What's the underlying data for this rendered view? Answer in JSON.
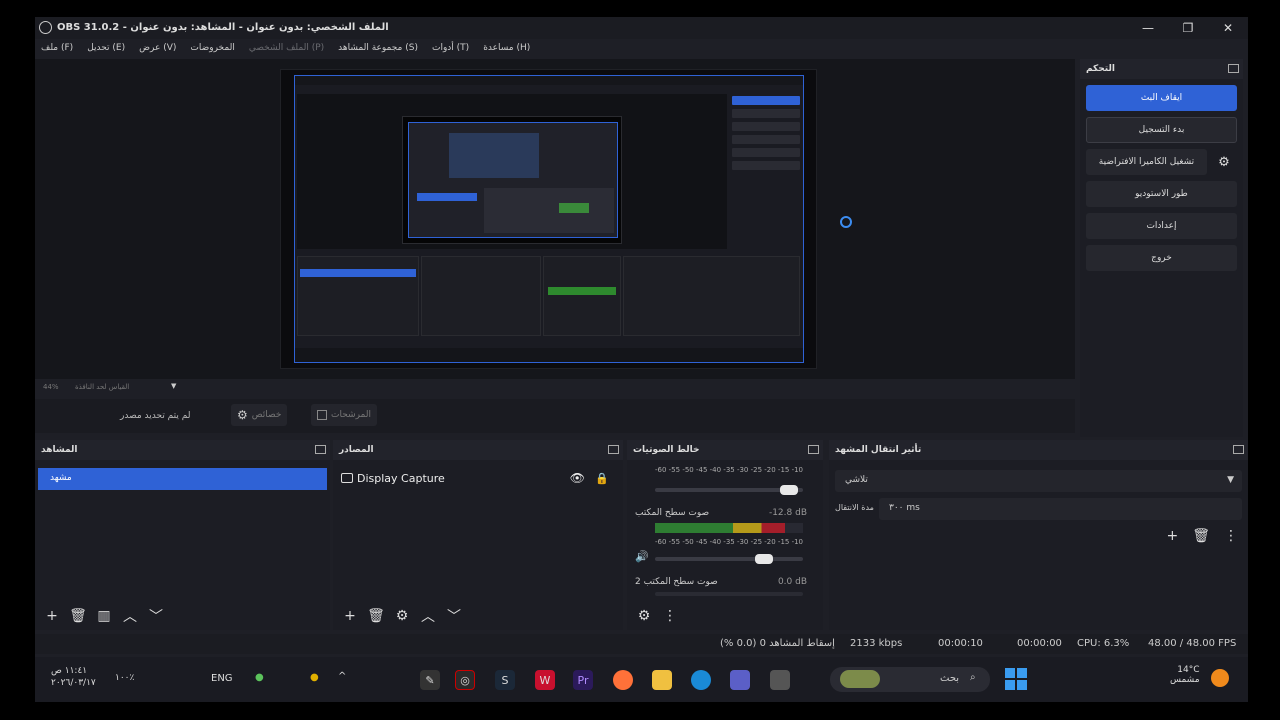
{
  "window": {
    "title": "OBS 31.0.2 - الملف الشخصي: بدون عنوان - المشاهد: بدون عنوان",
    "controls": [
      "—",
      "❐",
      "✕"
    ]
  },
  "menu": {
    "file": "ملف (F)",
    "edit": "تحديل (E)",
    "view": "عرض (V)",
    "docks": "المخروضات",
    "profile": "الملف الشخصي (P)",
    "scene_collection": "مجموعة المشاهد (S)",
    "tools": "أدوات (T)",
    "help": "مساعدة (H)"
  },
  "preview": {
    "scale_pct": "44%",
    "scale_label": "القياس لحد النافذة",
    "caret": "▼"
  },
  "context": {
    "no_source": "لم يتم تحديد مصدر",
    "properties": "خصائص",
    "filters": "المرشحات"
  },
  "controls_dock": {
    "title": "التحكم",
    "stop_stream": "ايقاف البث",
    "start_record": "بدء التسجيل",
    "virtual_cam": "تشغيل الكاميرا الافتراضية",
    "studio_mode": "طور الاستوديو",
    "settings": "إعدادات",
    "exit": "خروج",
    "gear": "⚙"
  },
  "scenes": {
    "title": "المشاهد",
    "items": [
      "مشهد"
    ]
  },
  "sources": {
    "title": "المصادر",
    "items": [
      {
        "name": "Display Capture"
      }
    ]
  },
  "mixer": {
    "title": "خالط الصوتيات",
    "ticks": "-60 -55 -50 -45 -40 -35 -30 -25 -20 -15 -10 -5 0",
    "channels": [
      {
        "name": "صوت سطح المكتب",
        "db": "-12.8 dB",
        "level": 0.9,
        "volume": 0.77
      },
      {
        "name": "صوت سطح المكتب 2",
        "db": "0.0 dB",
        "level": 0.0,
        "volume": 0.8
      }
    ]
  },
  "transitions": {
    "title": "تأثير انتقال المشهد",
    "selected": "تلاشي",
    "duration_label": "مدة الانتقال",
    "duration": "٣٠٠ ms"
  },
  "status": {
    "dropped": "إسقاط المشاهد 0 (0.0 %)",
    "bitrate": "2133 kbps",
    "stream_time": "00:00:10",
    "rec_time": "00:00:00",
    "cpu": "CPU: 6.3%",
    "fps": "48.00 / 48.00 FPS"
  },
  "taskbar": {
    "time": "١١:٤١ ص",
    "date": "٢٠٢٦/٠٣/١٧",
    "lang": "ENG",
    "battery": "١٠٠٪",
    "search_placeholder": "بحث",
    "temp": "14°C",
    "weather": "مشمس",
    "apps": [
      "steam-icon",
      "obs-icon",
      "wps-icon",
      "premiere-icon",
      "firefox-icon",
      "explorer-icon",
      "edge-icon",
      "teams-icon",
      "files-icon"
    ]
  }
}
